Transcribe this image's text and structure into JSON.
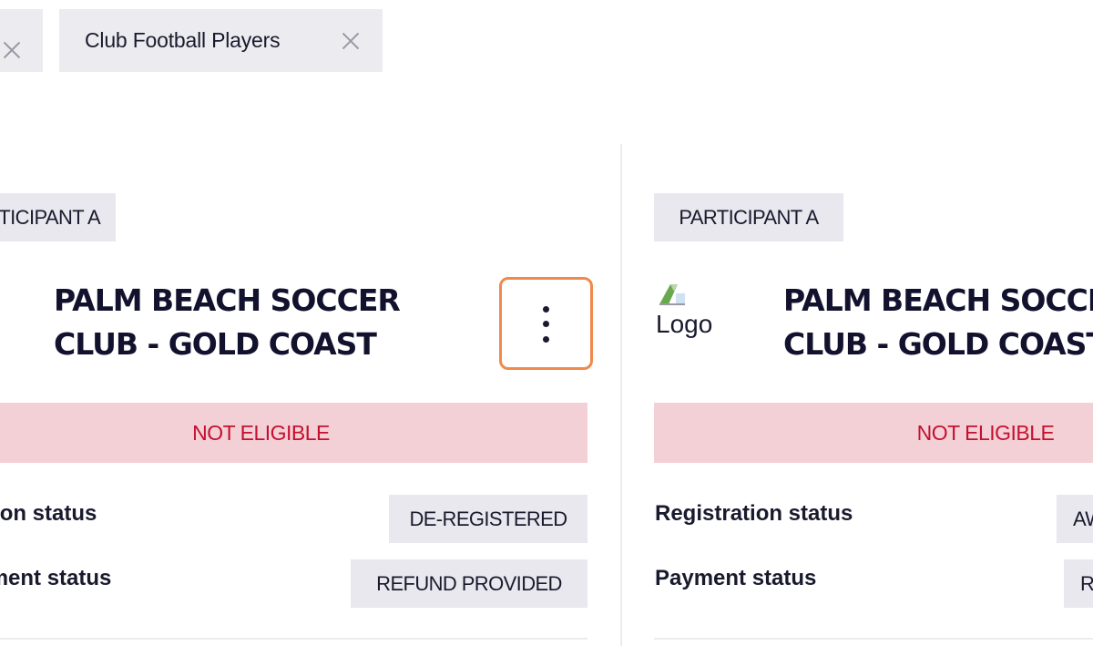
{
  "tabs": [
    {
      "label": ""
    },
    {
      "label": "Club Football Players"
    }
  ],
  "cards": [
    {
      "participant_label": "PARTICIPANT A",
      "club_name_line1": "PALM BEACH SOCCER",
      "club_name_line2": "CLUB - GOLD COAST",
      "eligibility": "NOT ELIGIBLE",
      "rows": [
        {
          "label": "Registration status",
          "value": "DE-REGISTERED"
        },
        {
          "label": "Payment status",
          "value": "REFUND PROVIDED"
        }
      ]
    },
    {
      "participant_label": "PARTICIPANT A",
      "logo_alt": "Logo",
      "club_name_line1": "PALM BEACH SOCCER",
      "club_name_line2": "CLUB - GOLD COAST",
      "eligibility": "NOT ELIGIBLE",
      "rows": [
        {
          "label": "Registration status",
          "value": "AWAITING"
        },
        {
          "label": "Payment status",
          "value": "REFUND PROVIDED"
        }
      ]
    }
  ],
  "icons": {
    "tab_close": "close-icon",
    "card_menu": "more-vertical-icon",
    "broken_image": "broken-image-icon"
  },
  "colors": {
    "highlight": "#f08a4b",
    "not_eligible_bg": "#f3d0d6",
    "not_eligible_text": "#c4102f",
    "chip_bg": "#e8e8ee"
  }
}
